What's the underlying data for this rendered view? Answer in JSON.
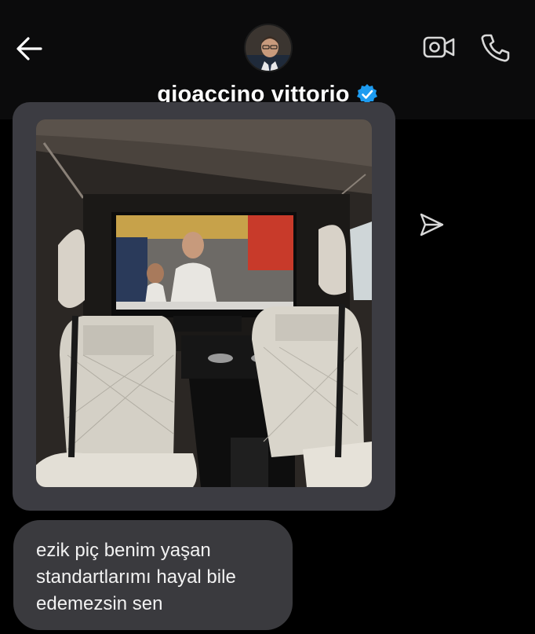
{
  "header": {
    "contact_name": "gioaccino vittorio",
    "back_icon": "arrow-left-icon",
    "video_icon": "video-camera-icon",
    "call_icon": "phone-icon",
    "verified_icon": "verified-badge-icon",
    "verified_color": "#1d9bf0"
  },
  "chat": {
    "shared_photo": {
      "subject": "luxury van interior with TV screen"
    },
    "share_icon": "send-icon",
    "message": "ezik piç benim yaşan standartlarımı hayal bile edemezsin sen"
  },
  "colors": {
    "background": "#000000",
    "header_bg": "#0b0b0c",
    "bubble": "#3a3a3e",
    "photo_card": "#3c3c42"
  }
}
